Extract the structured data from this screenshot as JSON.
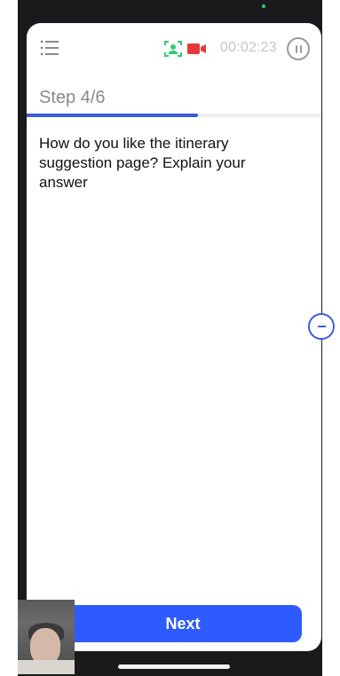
{
  "app": {
    "menu_icon": "list-icon",
    "recording": {
      "camera_icon": "face-frame-icon",
      "video_icon": "video-camera-icon",
      "camera_color": "#2ecc71",
      "video_color": "#e53935"
    },
    "timer": "00:02:23",
    "pause_icon": "pause-circle-icon"
  },
  "step": {
    "label": "Step 4/6",
    "current": 4,
    "total": 6,
    "progress_fraction": 0.58
  },
  "question": {
    "text": "How do you like the itinerary suggestion page? Explain your answer"
  },
  "actions": {
    "next_label": "Next"
  },
  "side_handle_icon": "minus-circle-icon",
  "colors": {
    "accent": "#2e5bff",
    "progress": "#3b5bdb"
  },
  "webcam": {
    "description_icon": "webcam-preview"
  }
}
